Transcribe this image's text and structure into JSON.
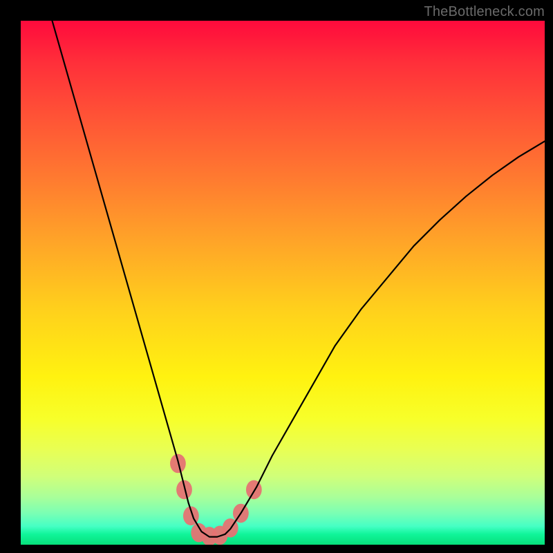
{
  "watermark": "TheBottleneck.com",
  "chart_data": {
    "type": "line",
    "title": "",
    "xlabel": "",
    "ylabel": "",
    "xlim": [
      0,
      100
    ],
    "ylim": [
      0,
      100
    ],
    "grid": false,
    "series": [
      {
        "name": "bottleneck-curve",
        "x": [
          6,
          8,
          10,
          12,
          14,
          16,
          18,
          20,
          22,
          24,
          26,
          28,
          30,
          31,
          32,
          33,
          34.5,
          36,
          37.5,
          39,
          40,
          42,
          45,
          48,
          52,
          56,
          60,
          65,
          70,
          75,
          80,
          85,
          90,
          95,
          100
        ],
        "values": [
          100,
          93,
          86,
          79,
          72,
          65,
          58,
          51,
          44,
          37,
          30,
          23,
          16,
          12,
          8,
          5,
          2.5,
          1.5,
          1.5,
          2,
          3,
          6,
          11,
          17,
          24,
          31,
          38,
          45,
          51,
          57,
          62,
          66.5,
          70.5,
          74,
          77
        ]
      }
    ],
    "markers": [
      {
        "name": "highlight-left-upper",
        "x": 30.0,
        "y": 15.5
      },
      {
        "name": "highlight-left-mid",
        "x": 31.2,
        "y": 10.5
      },
      {
        "name": "highlight-left-lower",
        "x": 32.5,
        "y": 5.5
      },
      {
        "name": "highlight-valley-1",
        "x": 34.0,
        "y": 2.3
      },
      {
        "name": "highlight-valley-2",
        "x": 36.0,
        "y": 1.6
      },
      {
        "name": "highlight-valley-3",
        "x": 38.0,
        "y": 1.8
      },
      {
        "name": "highlight-right-lower",
        "x": 40.0,
        "y": 3.2
      },
      {
        "name": "highlight-right-mid",
        "x": 42.0,
        "y": 6.0
      },
      {
        "name": "highlight-right-upper",
        "x": 44.5,
        "y": 10.5
      }
    ],
    "marker_style": {
      "color": "#e57373",
      "radius_px": 12
    }
  },
  "colors": {
    "curve_stroke": "#000000",
    "marker_fill": "#e57373"
  }
}
